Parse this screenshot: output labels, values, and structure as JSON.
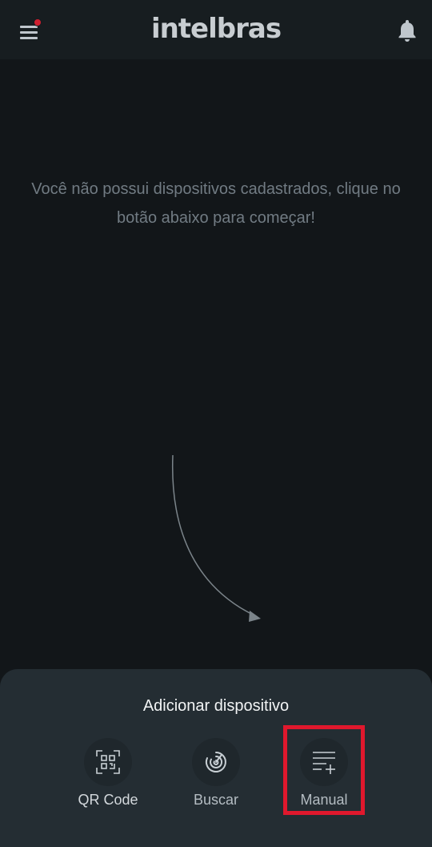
{
  "header": {
    "logo_text": "intelbras",
    "menu_icon": "hamburger-menu-icon",
    "notification_dot_color": "#d01f2f",
    "bell_icon": "bell-icon"
  },
  "main": {
    "empty_message": "Você não possui dispositivos cadastrados, clique no botão abaixo para começar!"
  },
  "add_device_sheet": {
    "title": "Adicionar dispositivo",
    "options": [
      {
        "label": "QR Code",
        "icon": "qr-code-icon"
      },
      {
        "label": "Buscar",
        "icon": "radar-search-icon"
      },
      {
        "label": "Manual",
        "icon": "list-add-icon"
      }
    ],
    "highlight_color": "#e0182d"
  }
}
